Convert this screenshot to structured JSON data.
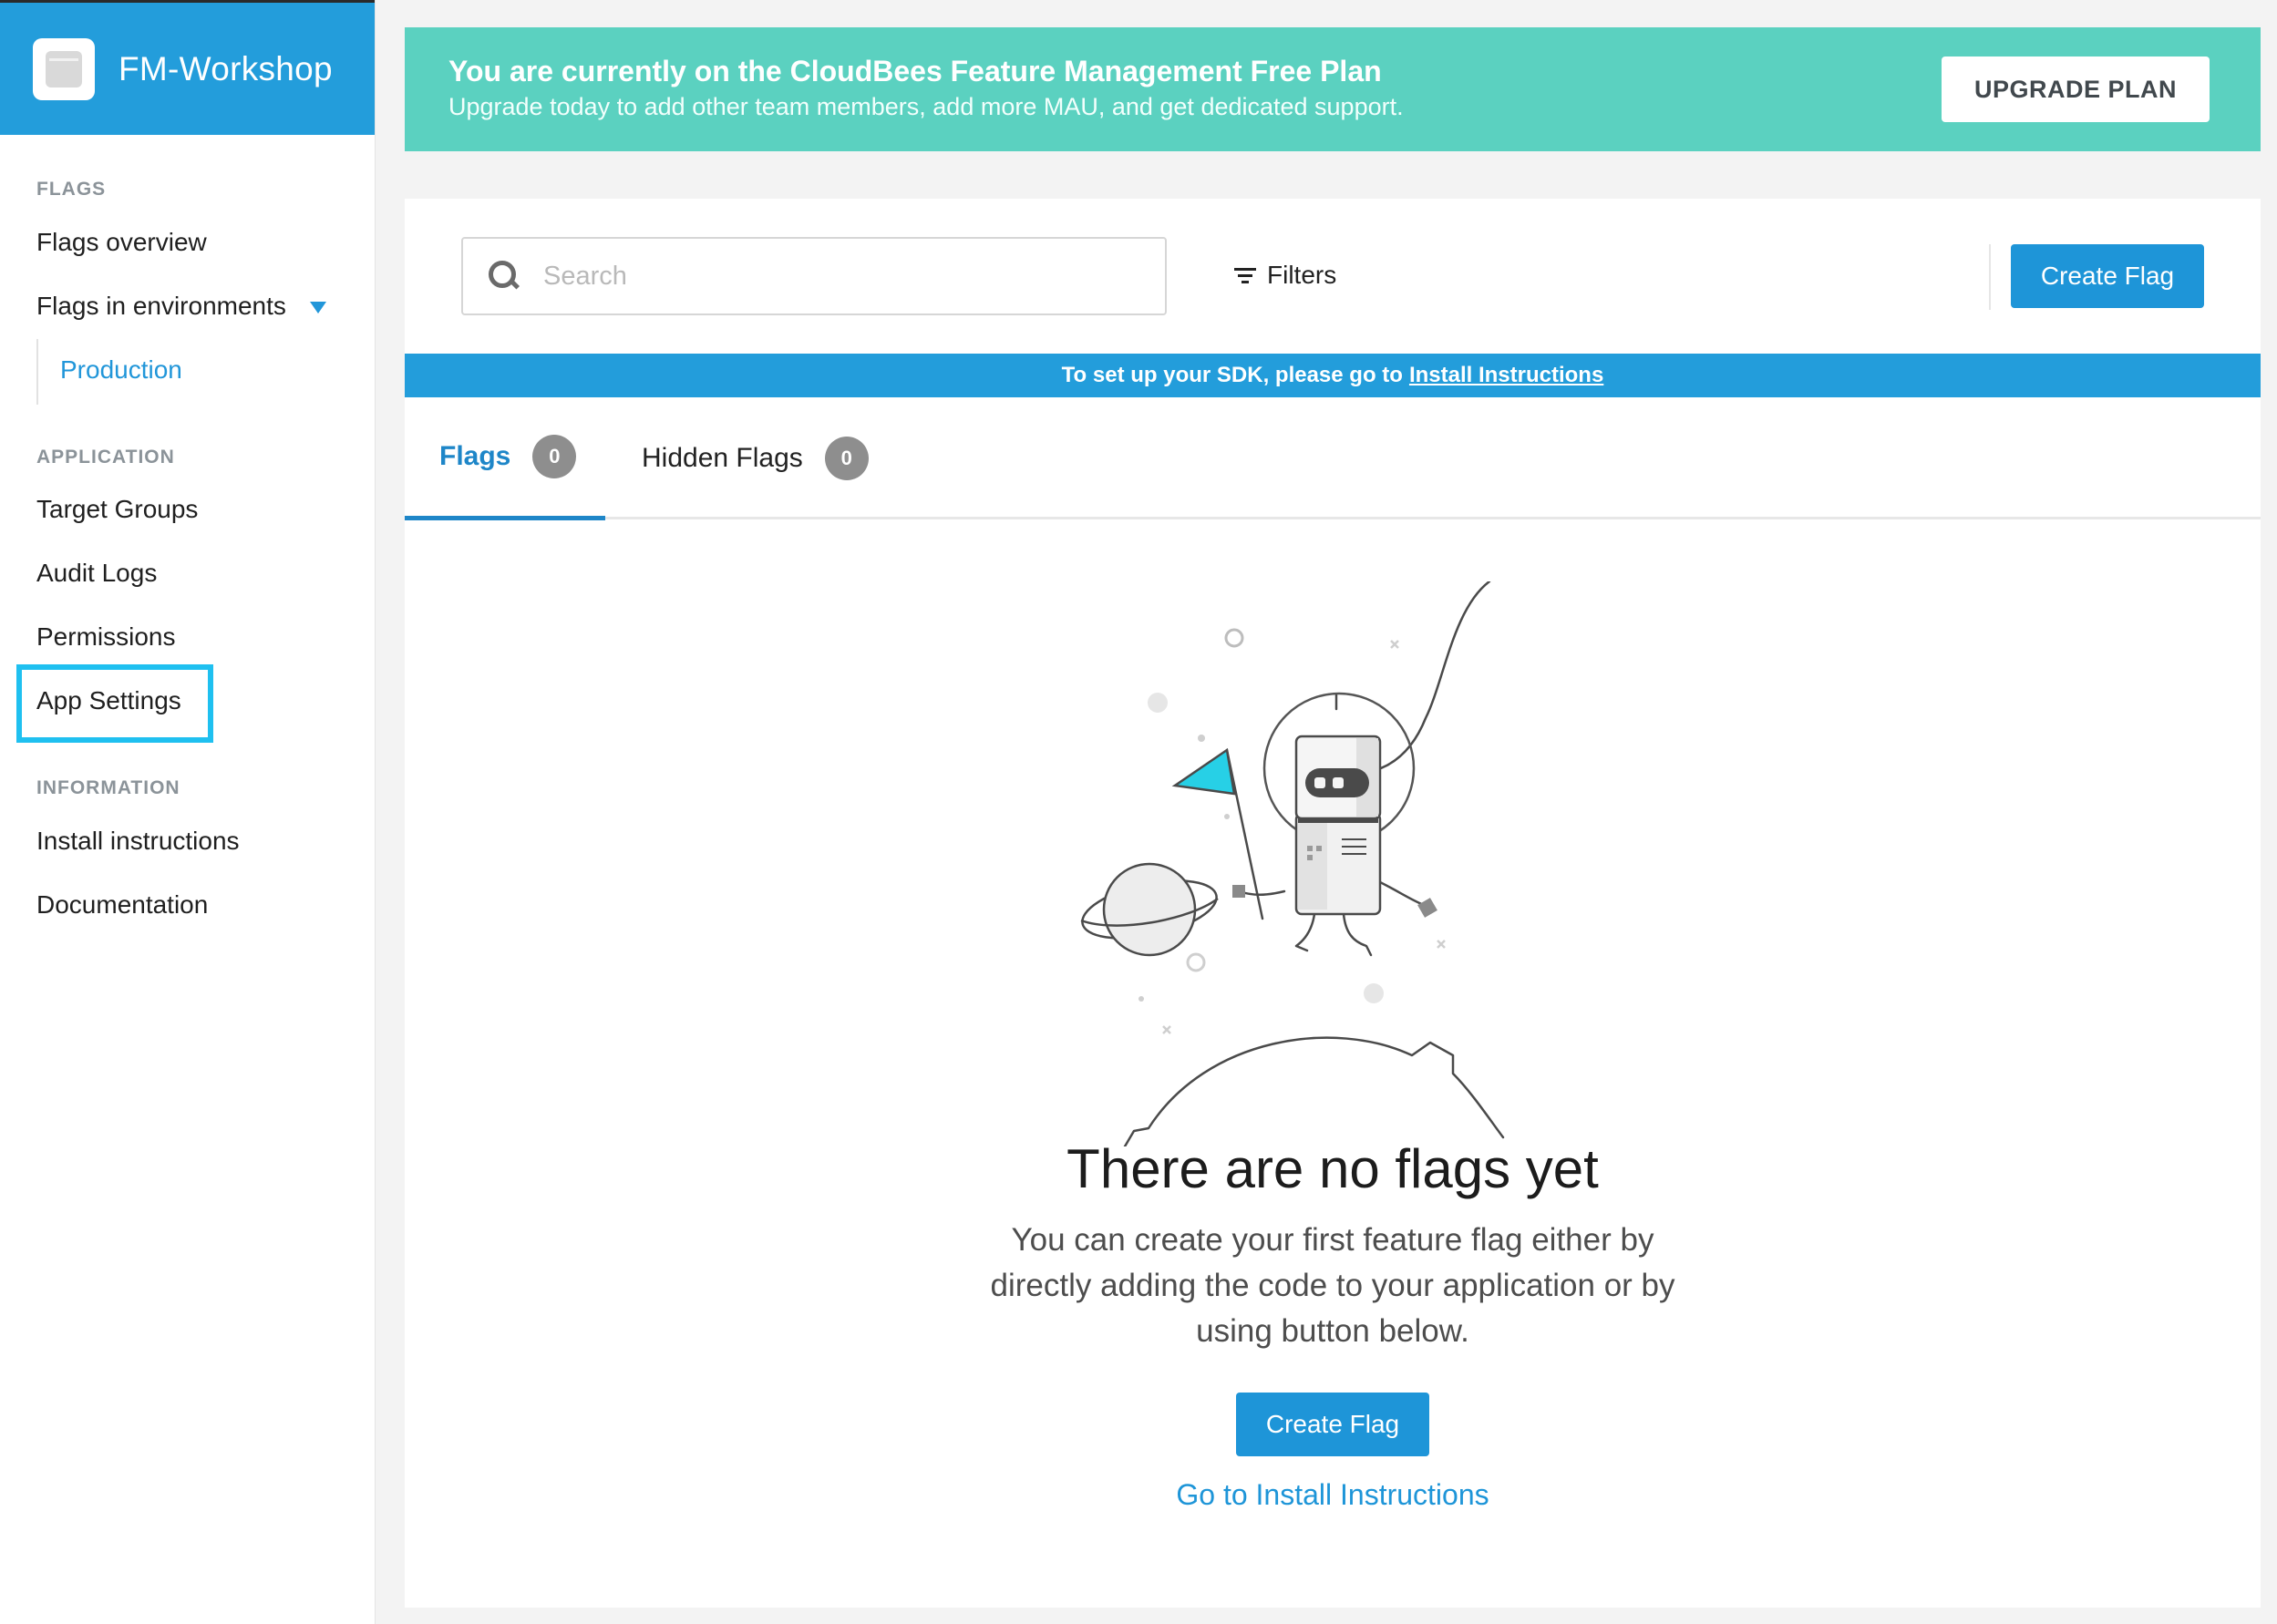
{
  "app": {
    "title": "FM-Workshop"
  },
  "sidebar": {
    "sections": [
      {
        "label": "FLAGS"
      },
      {
        "label": "APPLICATION"
      },
      {
        "label": "INFORMATION"
      }
    ],
    "items": {
      "flags_overview": "Flags overview",
      "flags_in_environments": "Flags in environments",
      "production": "Production",
      "target_groups": "Target Groups",
      "audit_logs": "Audit Logs",
      "permissions": "Permissions",
      "app_settings": "App Settings",
      "install_instructions": "Install instructions",
      "documentation": "Documentation"
    }
  },
  "banner": {
    "title": "You are currently on the CloudBees Feature Management Free Plan",
    "subtitle": "Upgrade today to add other team members, add more MAU, and get dedicated support.",
    "button": "UPGRADE PLAN"
  },
  "toolbar": {
    "search_placeholder": "Search",
    "filters": "Filters",
    "create_flag": "Create Flag"
  },
  "sdk_bar": {
    "text": "To set up your SDK, please go to",
    "link": "Install Instructions"
  },
  "tabs": [
    {
      "label": "Flags",
      "count": "0"
    },
    {
      "label": "Hidden Flags",
      "count": "0"
    }
  ],
  "empty_state": {
    "title": "There are no flags yet",
    "description": "You can create your first feature flag either by directly adding the code to your application or by using button below.",
    "button": "Create Flag",
    "link": "Go to Install Instructions"
  },
  "colors": {
    "brand_blue": "#239ddb",
    "banner_teal": "#5bd1c0",
    "highlight": "#1fc0f0"
  }
}
